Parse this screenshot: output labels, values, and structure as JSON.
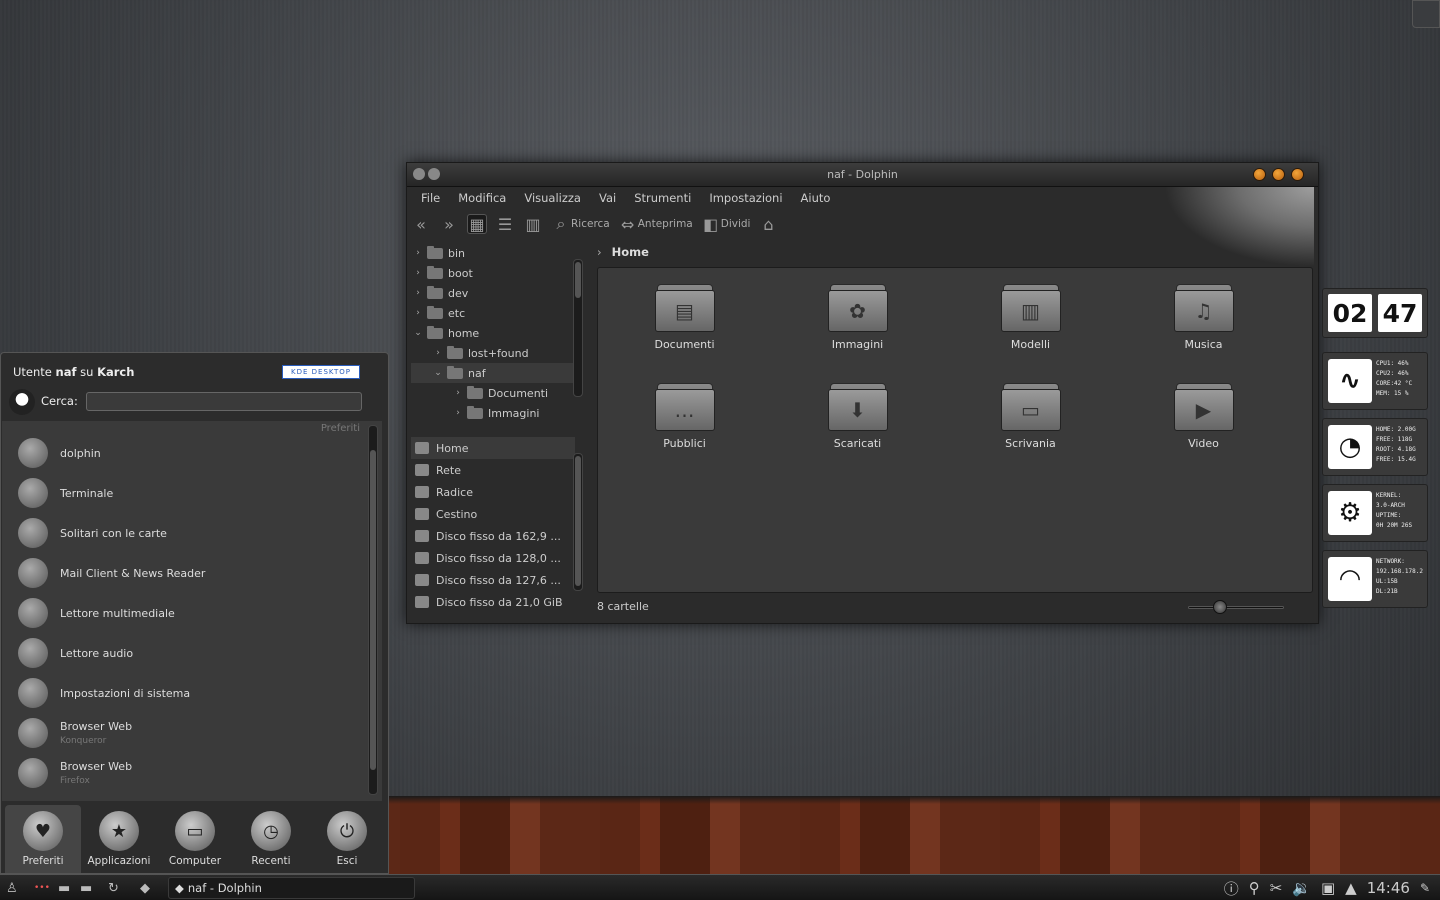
{
  "window": {
    "title": "naf - Dolphin",
    "menu": [
      "File",
      "Modifica",
      "Visualizza",
      "Vai",
      "Strumenti",
      "Impostazioni",
      "Aiuto"
    ],
    "toolbar": {
      "search": "Ricerca",
      "preview": "Anteprima",
      "split": "Dividi"
    },
    "tree": [
      {
        "label": "bin",
        "arrow": "›",
        "indent": 0
      },
      {
        "label": "boot",
        "arrow": "›",
        "indent": 0
      },
      {
        "label": "dev",
        "arrow": "›",
        "indent": 0
      },
      {
        "label": "etc",
        "arrow": "›",
        "indent": 0
      },
      {
        "label": "home",
        "arrow": "⌄",
        "indent": 0
      },
      {
        "label": "lost+found",
        "arrow": "›",
        "indent": 1
      },
      {
        "label": "naf",
        "arrow": "⌄",
        "indent": 1
      },
      {
        "label": "Documenti",
        "arrow": "›",
        "indent": 2
      },
      {
        "label": "Immagini",
        "arrow": "›",
        "indent": 2
      }
    ],
    "places": [
      "Home",
      "Rete",
      "Radice",
      "Cestino",
      "Disco fisso da 162,9 ...",
      "Disco fisso da 128,0 ...",
      "Disco fisso da 127,6 ...",
      "Disco fisso da 21,0 GiB"
    ],
    "breadcrumb": "Home",
    "folders": [
      {
        "label": "Documenti",
        "glyph": "▤"
      },
      {
        "label": "Immagini",
        "glyph": "✿"
      },
      {
        "label": "Modelli",
        "glyph": "▥"
      },
      {
        "label": "Musica",
        "glyph": "♫"
      },
      {
        "label": "Pubblici",
        "glyph": "…"
      },
      {
        "label": "Scaricati",
        "glyph": "⬇"
      },
      {
        "label": "Scrivania",
        "glyph": "▭"
      },
      {
        "label": "Video",
        "glyph": "▶"
      }
    ],
    "status": "8 cartelle",
    "zoom_level": 0.3
  },
  "kickoff": {
    "user_prefix": "Utente",
    "user": "naf",
    "host_prefix": "su",
    "host": "Karch",
    "badge": "KDE DESKTOP",
    "search_label": "Cerca:",
    "favorites_header": "Preferiti",
    "favorites": [
      {
        "label": "dolphin",
        "sub": ""
      },
      {
        "label": "Terminale",
        "sub": ""
      },
      {
        "label": "Solitari con le carte",
        "sub": ""
      },
      {
        "label": "Mail Client & News Reader",
        "sub": ""
      },
      {
        "label": "Lettore multimediale",
        "sub": ""
      },
      {
        "label": "Lettore audio",
        "sub": ""
      },
      {
        "label": "Impostazioni di sistema",
        "sub": ""
      },
      {
        "label": "Browser Web",
        "sub": "Konqueror"
      },
      {
        "label": "Browser Web",
        "sub": "Firefox"
      }
    ],
    "tabs": [
      {
        "label": "Preferiti",
        "glyph": "♥"
      },
      {
        "label": "Applicazioni",
        "glyph": "★"
      },
      {
        "label": "Computer",
        "glyph": "▭"
      },
      {
        "label": "Recenti",
        "glyph": "◷"
      },
      {
        "label": "Esci",
        "glyph": "⏻"
      }
    ]
  },
  "widgets": {
    "clock": {
      "hours": "02",
      "minutes": "47"
    },
    "cpu": [
      "CPU1: 46%",
      "CPU2: 46%",
      "CORE:42 °C",
      "MEM: 15 %"
    ],
    "disk": [
      "HOME: 2.00G",
      "FREE: 118G",
      "ROOT: 4.18G",
      "FREE: 15.4G"
    ],
    "system": [
      "KERNEL:",
      "3.0-ARCH",
      "UPTIME:",
      "0H 20M 26S"
    ],
    "network": [
      "NETWORK:",
      "192.168.178.2",
      "UL:15B",
      "DL:21B"
    ]
  },
  "taskbar": {
    "task": "naf - Dolphin",
    "clock": "14:46"
  }
}
